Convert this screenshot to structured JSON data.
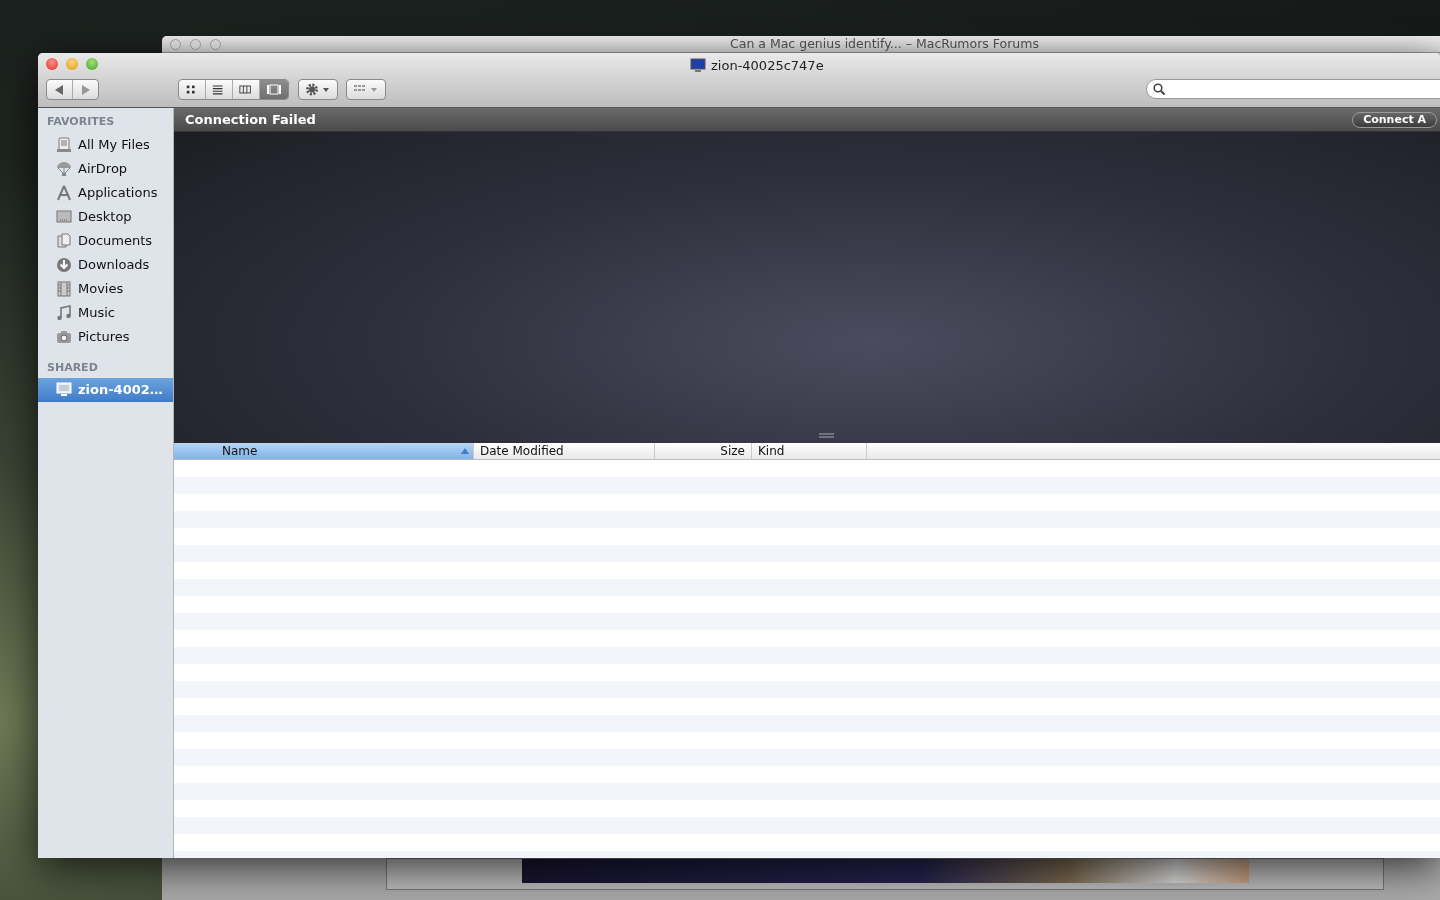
{
  "background_window": {
    "title": "Can a Mac genius identify... – MacRumors Forums"
  },
  "window": {
    "title": "zion-40025c747e"
  },
  "toolbar": {
    "view_buttons": [
      {
        "kind": "icons",
        "selected": false
      },
      {
        "kind": "list",
        "selected": false
      },
      {
        "kind": "columns",
        "selected": false
      },
      {
        "kind": "coverflow",
        "selected": true
      }
    ]
  },
  "sidebar": {
    "sections": [
      {
        "heading": "FAVORITES",
        "items": [
          {
            "label": "All My Files",
            "kind": "files",
            "selected": false
          },
          {
            "label": "AirDrop",
            "kind": "airdrop",
            "selected": false
          },
          {
            "label": "Applications",
            "kind": "apps",
            "selected": false
          },
          {
            "label": "Desktop",
            "kind": "desktop",
            "selected": false
          },
          {
            "label": "Documents",
            "kind": "documents",
            "selected": false
          },
          {
            "label": "Downloads",
            "kind": "downloads",
            "selected": false
          },
          {
            "label": "Movies",
            "kind": "movies",
            "selected": false
          },
          {
            "label": "Music",
            "kind": "music",
            "selected": false
          },
          {
            "label": "Pictures",
            "kind": "pictures",
            "selected": false
          }
        ]
      },
      {
        "heading": "SHARED",
        "items": [
          {
            "label": "zion-4002…",
            "kind": "computer",
            "selected": true
          }
        ]
      }
    ]
  },
  "coverflow": {
    "status": "Connection Failed",
    "button": "Connect A"
  },
  "table": {
    "columns": [
      {
        "label": "Name",
        "selected": true
      },
      {
        "label": "Date Modified",
        "selected": false
      },
      {
        "label": "Size",
        "selected": false
      },
      {
        "label": "Kind",
        "selected": false
      }
    ]
  }
}
